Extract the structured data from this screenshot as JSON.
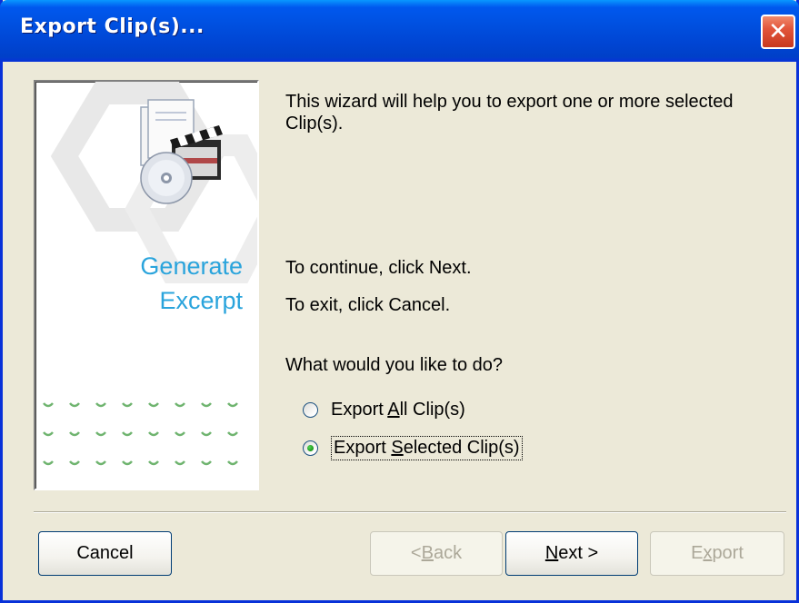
{
  "window": {
    "title": "Export Clip(s)...",
    "close_label": "✕"
  },
  "side_panel": {
    "title_line1": "Generate",
    "title_line2": "Excerpt",
    "accent_color": "#2aa4dc",
    "dots_color": "#6fb46f"
  },
  "content": {
    "intro_line1": "This wizard will help you to export one or more selected",
    "intro_line2": "Clip(s).",
    "continue_text": "To continue, click Next.",
    "exit_text": "To exit, click Cancel.",
    "question": "What would you like to do?"
  },
  "options": [
    {
      "mnemonic_before": "Export ",
      "mnemonic": "A",
      "mnemonic_after": "ll Clip(s)",
      "checked": false
    },
    {
      "mnemonic_before": "Export ",
      "mnemonic": "S",
      "mnemonic_after": "elected Clip(s)",
      "checked": true
    }
  ],
  "buttons": {
    "cancel": "Cancel",
    "back_prefix": "< ",
    "back_mnemonic": "B",
    "back_suffix": "ack",
    "next_mnemonic": "N",
    "next_suffix": "ext >",
    "export_prefix": "E",
    "export_mnemonic": "x",
    "export_suffix": "port"
  }
}
